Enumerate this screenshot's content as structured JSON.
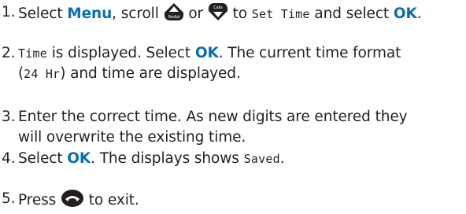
{
  "steps": [
    {
      "number": "1.",
      "select": "Select",
      "menu": "Menu",
      "scroll": ", scroll",
      "or": "or",
      "to": "to",
      "set_time": "Set Time",
      "and_select": "and select",
      "ok": "OK",
      "period": "."
    },
    {
      "number": "2.",
      "time": "Time",
      "is_displayed": " is displayed. Select ",
      "ok": "OK",
      "rest_1": ". The current time format",
      "open_paren": "(",
      "format": "24 Hr",
      "rest_2": ") and time are displayed."
    },
    {
      "number": "3.",
      "line_1": "Enter the correct time. As new digits are entered they",
      "line_2": "will overwrite the existing time."
    },
    {
      "number": "4.",
      "select": "Select ",
      "ok": "OK",
      "rest": ". The displays shows ",
      "saved": "Saved",
      "period": "."
    },
    {
      "number": "5.",
      "press": "Press",
      "to_exit": "to exit."
    }
  ],
  "icons": {
    "redial_button": {
      "icon": "up-arrow-redial-key-icon",
      "label": "Redial"
    },
    "calls_button": {
      "icon": "down-arrow-calls-key-icon",
      "label": "Calls"
    },
    "end_call_button": {
      "icon": "end-call-handset-icon"
    }
  },
  "colors": {
    "text": "#231f20",
    "accent": "#0a6eb4",
    "key_fill": "#231f20"
  }
}
